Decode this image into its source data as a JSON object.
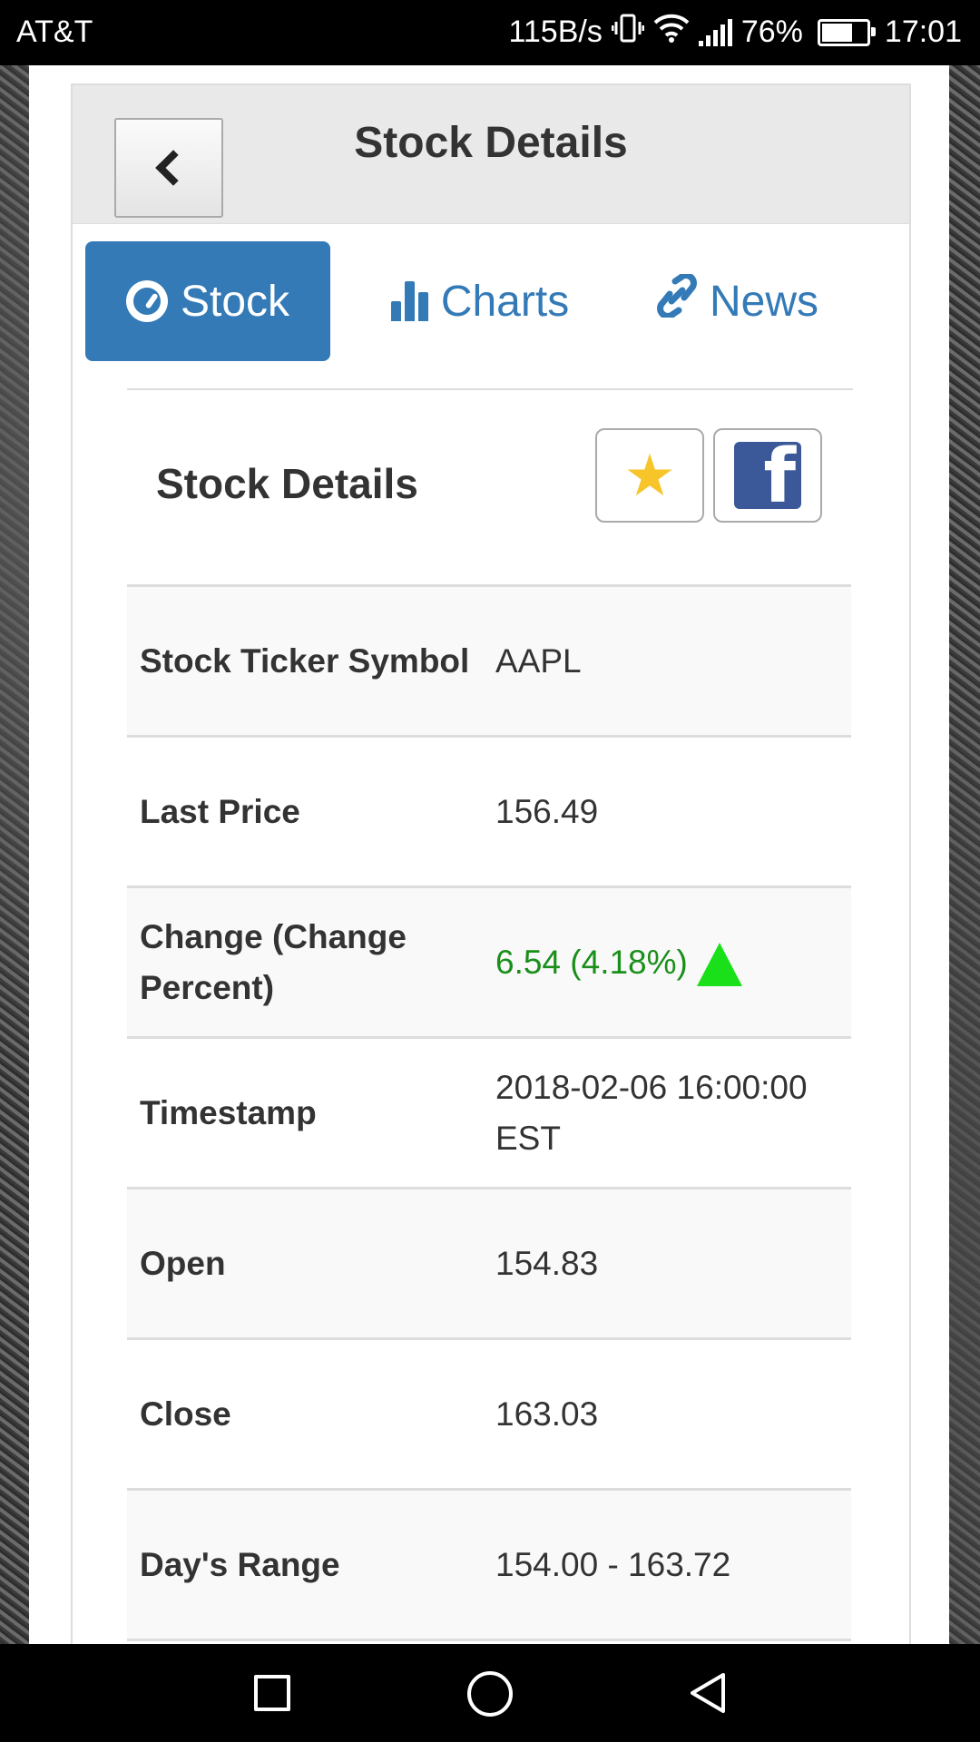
{
  "status_bar": {
    "carrier": "AT&T",
    "net_speed": "115B/s",
    "battery": "76%",
    "battery_level": 0.76,
    "time": "17:01"
  },
  "header": {
    "title": "Stock Details"
  },
  "tabs": [
    {
      "label": "Stock",
      "icon": "dashboard-icon",
      "active": true
    },
    {
      "label": "Charts",
      "icon": "bar-chart-icon",
      "active": false
    },
    {
      "label": "News",
      "icon": "link-icon",
      "active": false
    }
  ],
  "section": {
    "title": "Stock Details"
  },
  "details": [
    {
      "label": "Stock Ticker Symbol",
      "value": "AAPL"
    },
    {
      "label": "Last Price",
      "value": "156.49"
    },
    {
      "label": "Change (Change Percent)",
      "value": "6.54 (4.18%)"
    },
    {
      "label": "Timestamp",
      "value": "2018-02-06 16:00:00 EST"
    },
    {
      "label": "Open",
      "value": "154.83"
    },
    {
      "label": "Close",
      "value": "163.03"
    },
    {
      "label": "Day's Range",
      "value": "154.00 - 163.72"
    }
  ],
  "colors": {
    "accent": "#337ab7",
    "positive_change": "#1a8f1a",
    "up_arrow": "#19e019",
    "favorite_star": "#f7c52a",
    "facebook": "#3b5998"
  }
}
